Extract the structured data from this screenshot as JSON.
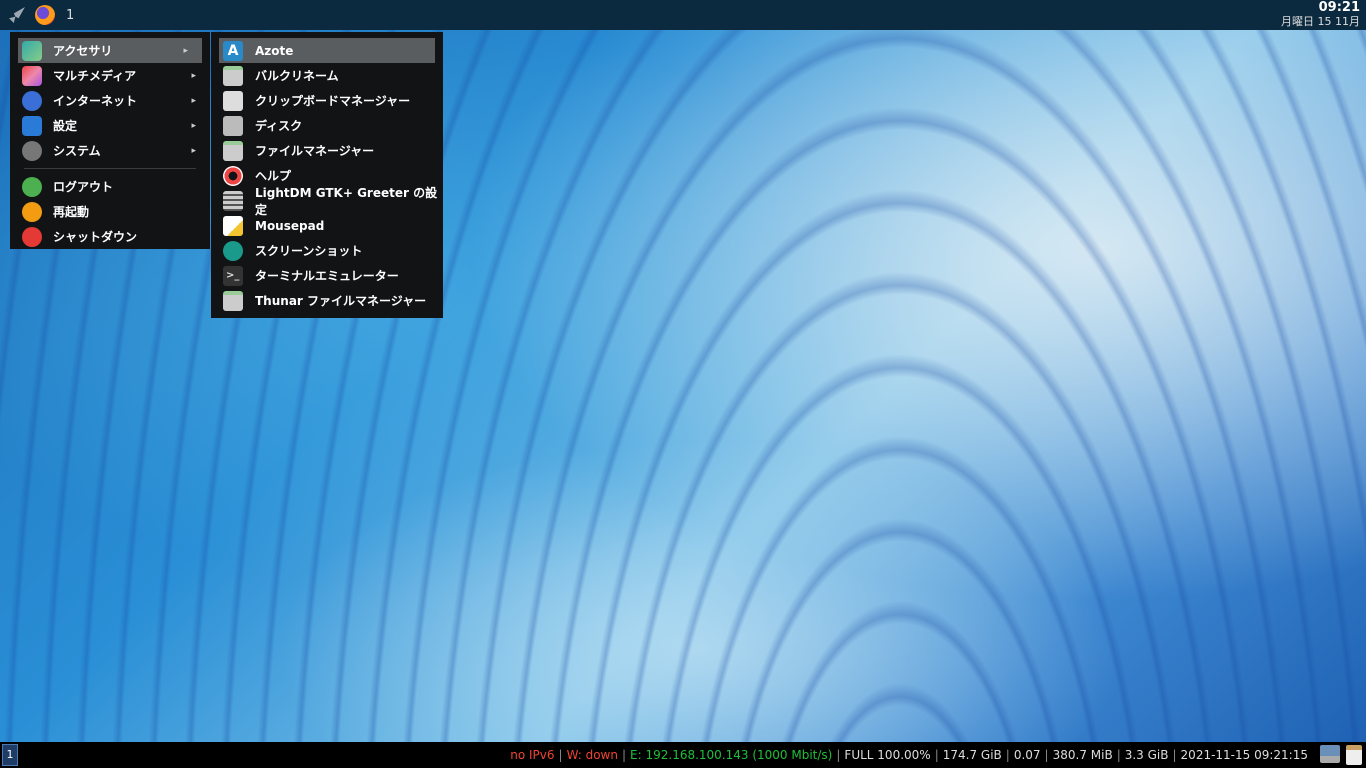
{
  "top_panel": {
    "workspace": "1",
    "time": "09:21",
    "date": "月曜日 15 11月"
  },
  "main_menu": {
    "items": [
      {
        "label": "アクセサリ",
        "icon": "accessories-icon"
      },
      {
        "label": "マルチメディア",
        "icon": "multimedia-icon"
      },
      {
        "label": "インターネット",
        "icon": "internet-icon"
      },
      {
        "label": "設定",
        "icon": "settings-icon"
      },
      {
        "label": "システム",
        "icon": "system-icon"
      }
    ],
    "actions": [
      {
        "label": "ログアウト",
        "icon": "logout-icon"
      },
      {
        "label": "再起動",
        "icon": "restart-icon"
      },
      {
        "label": "シャットダウン",
        "icon": "shutdown-icon"
      }
    ],
    "arrow": "▸"
  },
  "sub_menu": {
    "items": [
      {
        "label": "Azote",
        "icon": "azote-icon"
      },
      {
        "label": "バルクリネーム",
        "icon": "bulk-rename-icon"
      },
      {
        "label": "クリップボードマネージャー",
        "icon": "clipboard-manager-icon"
      },
      {
        "label": "ディスク",
        "icon": "disk-icon"
      },
      {
        "label": "ファイルマネージャー",
        "icon": "file-manager-icon"
      },
      {
        "label": "ヘルプ",
        "icon": "help-icon"
      },
      {
        "label": "LightDM GTK+ Greeter の設定",
        "icon": "lightdm-icon"
      },
      {
        "label": "Mousepad",
        "icon": "mousepad-icon"
      },
      {
        "label": "スクリーンショット",
        "icon": "screenshot-icon"
      },
      {
        "label": "ターミナルエミュレーター",
        "icon": "terminal-icon"
      },
      {
        "label": "Thunar ファイルマネージャー",
        "icon": "thunar-icon"
      }
    ]
  },
  "bottom_bar": {
    "workspace": "1",
    "ipv6": "no IPv6",
    "wireless": "W: down",
    "ethernet": "E: 192.168.100.143 (1000 Mbit/s)",
    "battery": "FULL 100.00%",
    "disk": "174.7 GiB",
    "load": "0.07",
    "memory_used": "380.7 MiB",
    "memory_total": "3.3 GiB",
    "datetime": "2021-11-15 09:21:15",
    "divider": "|"
  }
}
